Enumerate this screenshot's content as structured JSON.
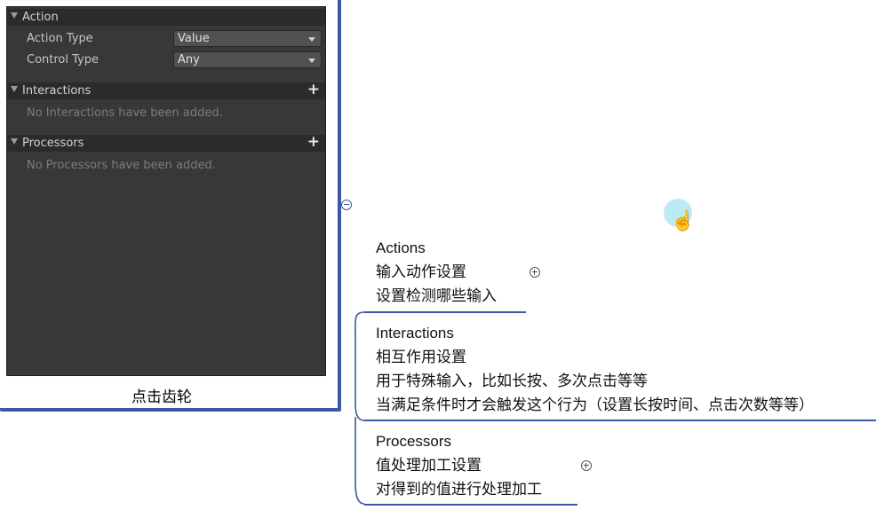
{
  "inspector": {
    "action_section": {
      "title": "Action",
      "rows": [
        {
          "label": "Action Type",
          "value": "Value"
        },
        {
          "label": "Control Type",
          "value": "Any"
        }
      ]
    },
    "interactions_section": {
      "title": "Interactions",
      "add_icon": "+",
      "empty_message": "No Interactions have been added."
    },
    "processors_section": {
      "title": "Processors",
      "add_icon": "+",
      "empty_message": "No Processors have been added."
    }
  },
  "caption": "点击齿轮",
  "mindmap": {
    "actions": {
      "title": "Actions",
      "lines": [
        "输入动作设置",
        "设置检测哪些输入"
      ]
    },
    "interactions": {
      "title": "Interactions",
      "lines": [
        "相互作用设置",
        "用于特殊输入，比如长按、多次点击等等",
        "当满足条件时才会触发这个行为（设置长按时间、点击次数等等）"
      ]
    },
    "processors": {
      "title": "Processors",
      "lines": [
        "值处理加工设置",
        "对得到的值进行处理加工"
      ]
    }
  },
  "colors": {
    "branch_line": "#3b57a6",
    "panel_bg": "#383838",
    "cursor_halo": "#aee8f2"
  }
}
